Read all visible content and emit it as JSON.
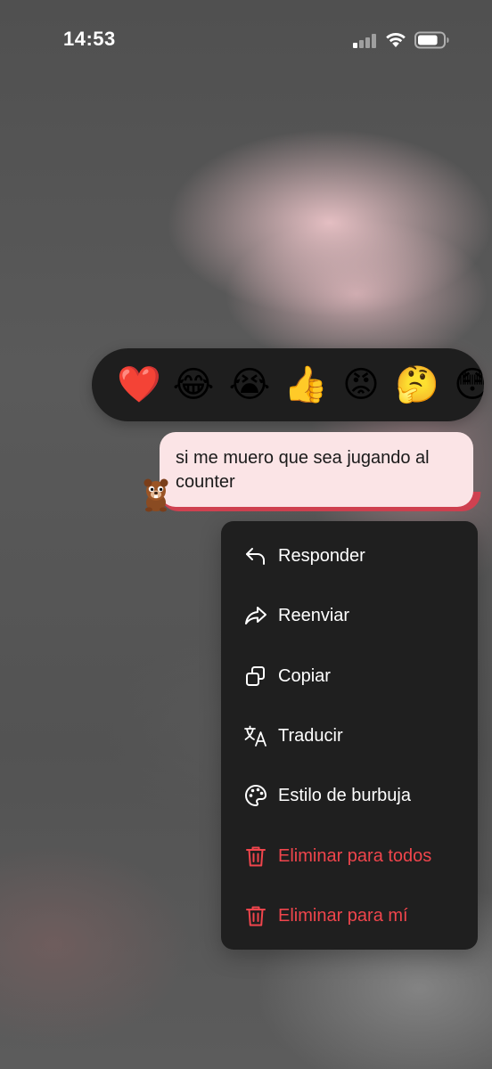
{
  "status_bar": {
    "time": "14:53",
    "signal_bars_active": 1,
    "signal_bars_total": 4,
    "battery_level": 0.8
  },
  "reactions": [
    {
      "emoji": "❤️",
      "icon": "red-heart"
    },
    {
      "emoji": "😂",
      "icon": "face-with-tears-of-joy"
    },
    {
      "emoji": "😭",
      "icon": "loudly-crying-face"
    },
    {
      "emoji": "👍",
      "icon": "thumbs-up"
    },
    {
      "emoji": "😡",
      "icon": "angry-face"
    },
    {
      "emoji": "🤔",
      "icon": "thinking-face"
    },
    {
      "emoji": "😳",
      "icon": "flushed-face"
    }
  ],
  "message": {
    "text": "si me muero que sea jugando al counter",
    "bubble_color": "#fbe4e6",
    "accent_color": "#cf4150",
    "avatar_icon": "bear-sticker"
  },
  "menu": {
    "items": [
      {
        "label": "Responder",
        "icon": "reply-icon",
        "danger": false
      },
      {
        "label": "Reenviar",
        "icon": "forward-icon",
        "danger": false
      },
      {
        "label": "Copiar",
        "icon": "copy-icon",
        "danger": false
      },
      {
        "label": "Traducir",
        "icon": "translate-icon",
        "danger": false
      },
      {
        "label": "Estilo de burbuja",
        "icon": "palette-icon",
        "danger": false
      },
      {
        "label": "Eliminar para todos",
        "icon": "trash-icon",
        "danger": true
      },
      {
        "label": "Eliminar para mí",
        "icon": "trash-icon",
        "danger": true
      }
    ],
    "danger_color": "#f0454c"
  }
}
